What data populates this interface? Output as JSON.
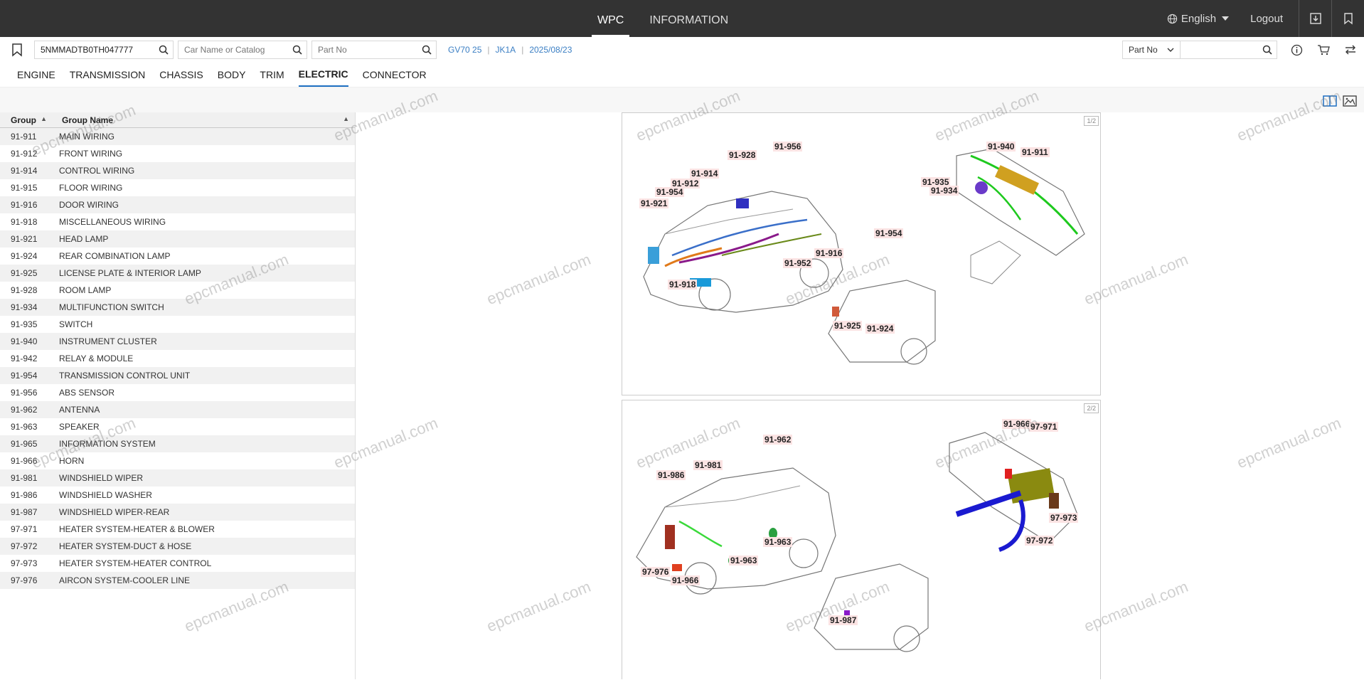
{
  "topbar": {
    "tabs": [
      "WPC",
      "INFORMATION"
    ],
    "language": "English",
    "logout": "Logout"
  },
  "search": {
    "vin_value": "5NMMADTB0TH047777",
    "car_placeholder": "Car Name or Catalog",
    "part_placeholder": "Part No",
    "crumbs": [
      "GV70 25",
      "JK1A",
      "2025/08/23"
    ],
    "right_dropdown": "Part No"
  },
  "categories": [
    "ENGINE",
    "TRANSMISSION",
    "CHASSIS",
    "BODY",
    "TRIM",
    "ELECTRIC",
    "CONNECTOR"
  ],
  "active_category": "ELECTRIC",
  "table": {
    "headers": [
      "Group",
      "Group Name"
    ],
    "rows": [
      [
        "91-911",
        "MAIN WIRING"
      ],
      [
        "91-912",
        "FRONT WIRING"
      ],
      [
        "91-914",
        "CONTROL WIRING"
      ],
      [
        "91-915",
        "FLOOR WIRING"
      ],
      [
        "91-916",
        "DOOR WIRING"
      ],
      [
        "91-918",
        "MISCELLANEOUS WIRING"
      ],
      [
        "91-921",
        "HEAD LAMP"
      ],
      [
        "91-924",
        "REAR COMBINATION LAMP"
      ],
      [
        "91-925",
        "LICENSE PLATE & INTERIOR LAMP"
      ],
      [
        "91-928",
        "ROOM LAMP"
      ],
      [
        "91-934",
        "MULTIFUNCTION SWITCH"
      ],
      [
        "91-935",
        "SWITCH"
      ],
      [
        "91-940",
        "INSTRUMENT CLUSTER"
      ],
      [
        "91-942",
        "RELAY & MODULE"
      ],
      [
        "91-954",
        "TRANSMISSION CONTROL UNIT"
      ],
      [
        "91-956",
        "ABS SENSOR"
      ],
      [
        "91-962",
        "ANTENNA"
      ],
      [
        "91-963",
        "SPEAKER"
      ],
      [
        "91-965",
        "INFORMATION SYSTEM"
      ],
      [
        "91-966",
        "HORN"
      ],
      [
        "91-981",
        "WINDSHIELD WIPER"
      ],
      [
        "91-986",
        "WINDSHIELD WASHER"
      ],
      [
        "91-987",
        "WINDSHIELD WIPER-REAR"
      ],
      [
        "97-971",
        "HEATER SYSTEM-HEATER & BLOWER"
      ],
      [
        "97-972",
        "HEATER SYSTEM-DUCT & HOSE"
      ],
      [
        "97-973",
        "HEATER SYSTEM-HEATER CONTROL"
      ],
      [
        "97-976",
        "AIRCON SYSTEM-COOLER LINE"
      ]
    ]
  },
  "diagram": {
    "page1_no": "1/2",
    "page2_no": "2/2",
    "page1_labels": [
      "91-956",
      "91-928",
      "91-914",
      "91-912",
      "91-954",
      "91-921",
      "91-940",
      "91-911",
      "91-935",
      "91-934",
      "91-954",
      "91-916",
      "91-952",
      "91-918",
      "91-925",
      "91-924"
    ],
    "page2_labels": [
      "91-962",
      "91-981",
      "91-986",
      "91-966",
      "97-971",
      "97-973",
      "97-972",
      "91-963",
      "91-963",
      "97-976",
      "91-966",
      "91-987"
    ]
  },
  "watermark": "epcmanual.com",
  "colors": {
    "topbar": "#333333",
    "accent": "#1e6fc2",
    "crumb": "#3b7fc4"
  }
}
